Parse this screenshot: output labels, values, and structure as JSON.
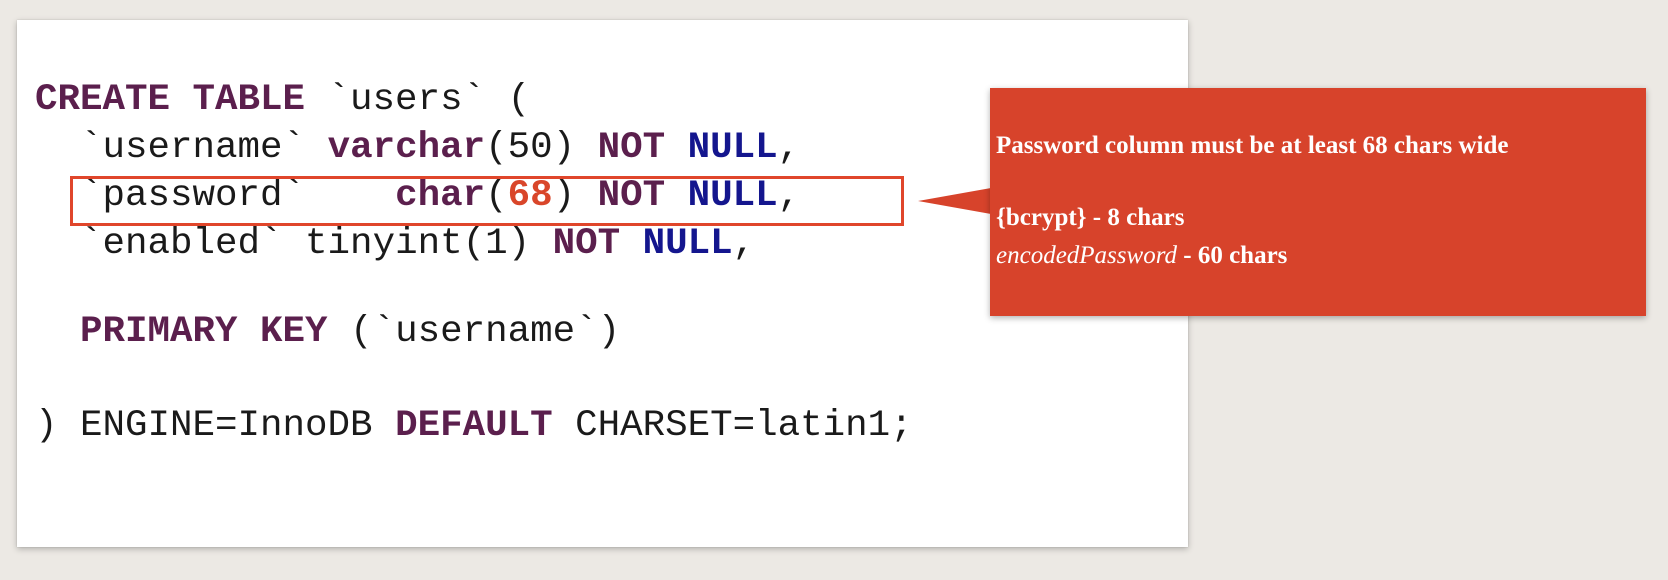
{
  "code": {
    "line1": {
      "kw1": "CREATE TABLE",
      "rest": " `users` ("
    },
    "line2": {
      "indent": "  ",
      "col": "`username` ",
      "type": "varchar",
      "args": "(50) ",
      "notkw": "NOT",
      "space": " ",
      "nullkw": "NULL",
      "tail": ","
    },
    "line3": {
      "indent": "  ",
      "col": "`password`    ",
      "type": "char",
      "open": "(",
      "num": "68",
      "close": ") ",
      "notkw": "NOT",
      "space": " ",
      "nullkw": "NULL",
      "tail": ","
    },
    "line4": {
      "indent": "  ",
      "col": "`enabled` tinyint(1) ",
      "notkw": "NOT",
      "space": " ",
      "nullkw": "NULL",
      "tail": ","
    },
    "line5": {
      "indent": "  ",
      "kw": "PRIMARY KEY",
      "rest": " (`username`)"
    },
    "line6": {
      "open": ") ENGINE=InnoDB ",
      "kw": "DEFAULT",
      "rest": " CHARSET=latin1;"
    }
  },
  "callout": {
    "title": "Password column must be at least 68 chars wide",
    "row1": "{bcrypt} - 8 chars",
    "row2_em": "encodedPassword",
    "row2_rest": " - 60 chars"
  },
  "colors": {
    "keyword": "#5b1f4d",
    "null_keyword": "#14168e",
    "number": "#d9462a",
    "callout_bg": "#d7432b",
    "highlight_border": "#e0462b"
  }
}
